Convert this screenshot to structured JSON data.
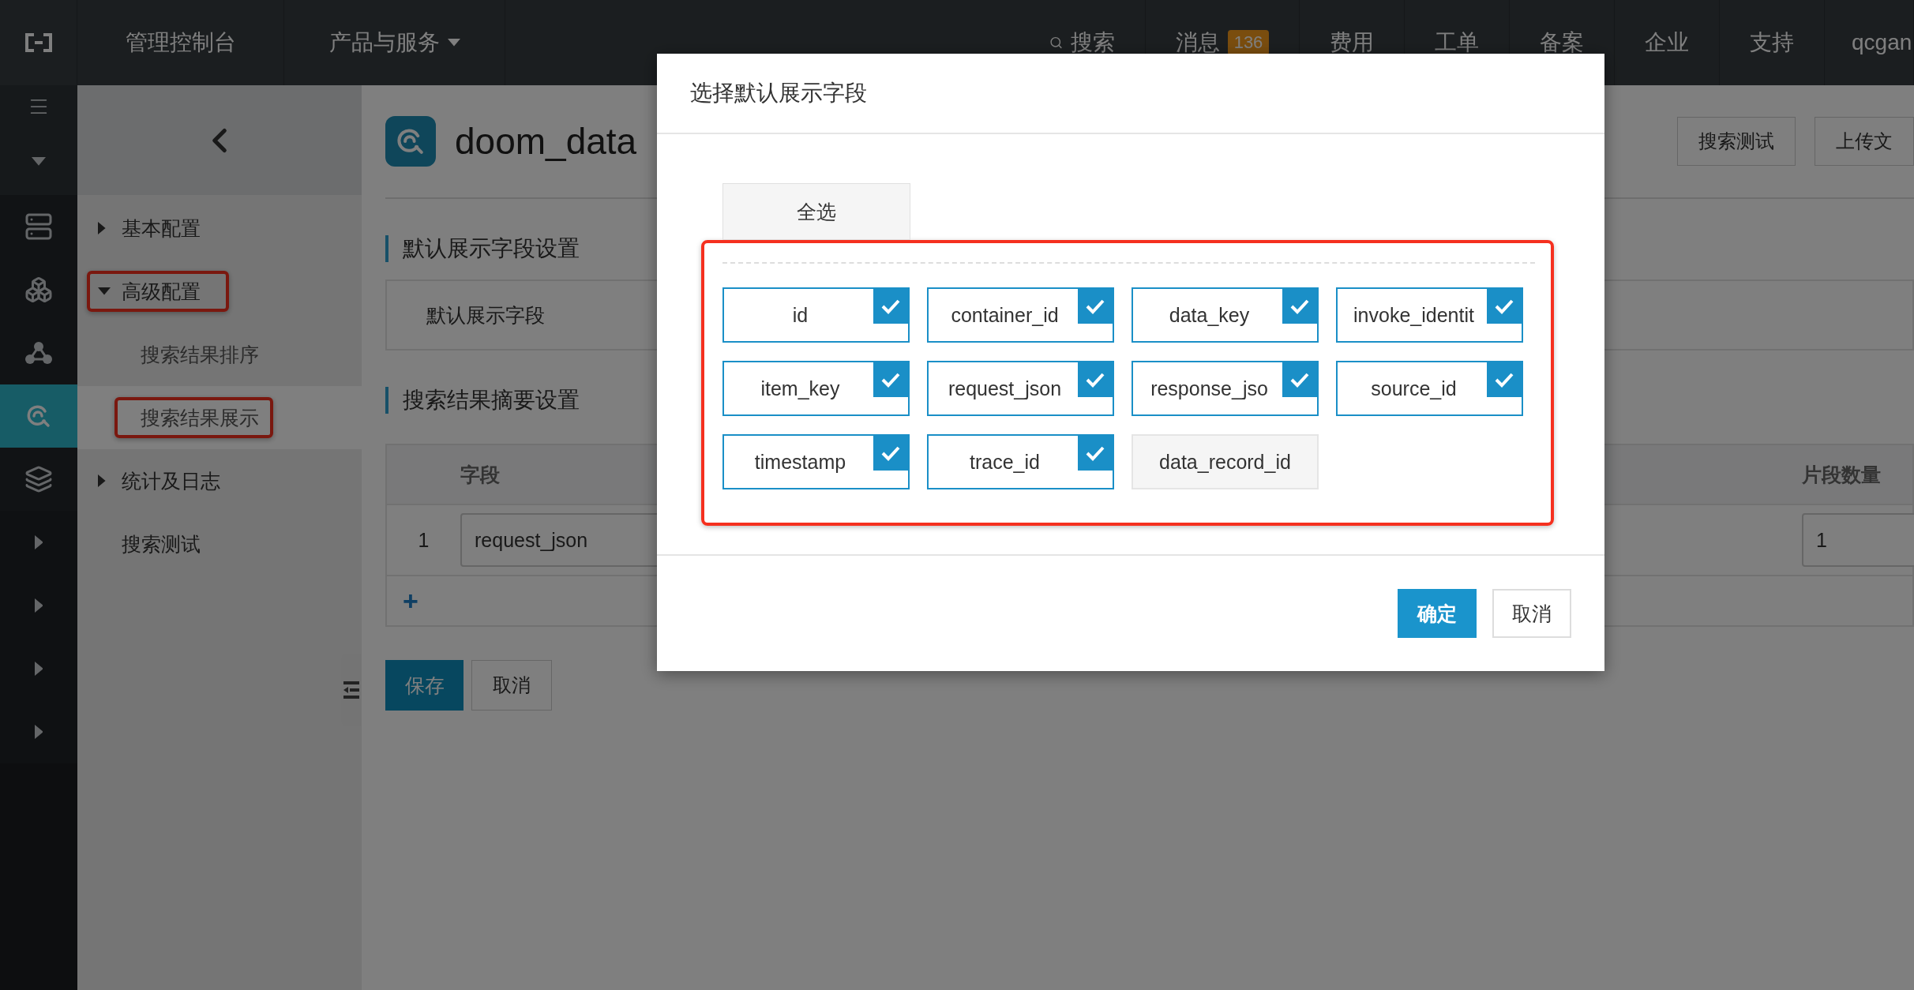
{
  "topbar": {
    "console": "管理控制台",
    "products": "产品与服务",
    "search": "搜索",
    "messages": {
      "label": "消息",
      "count": "136"
    },
    "links": [
      "费用",
      "工单",
      "备案",
      "企业",
      "支持"
    ],
    "user": "qcgan"
  },
  "rail": [
    {
      "kind": "menu",
      "selected": false
    },
    {
      "kind": "collapse",
      "selected": false
    },
    {
      "kind": "servers",
      "selected": false
    },
    {
      "kind": "cubes",
      "selected": false
    },
    {
      "kind": "nodes",
      "selected": false
    },
    {
      "kind": "search",
      "selected": true
    },
    {
      "kind": "layers",
      "selected": false
    },
    {
      "kind": "expand",
      "selected": false
    },
    {
      "kind": "expand",
      "selected": false
    },
    {
      "kind": "expand",
      "selected": false
    },
    {
      "kind": "expand",
      "selected": false
    }
  ],
  "sidebar": {
    "items": [
      {
        "kind": "group",
        "label": "基本配置",
        "expanded": false,
        "annotated": false
      },
      {
        "kind": "group",
        "label": "高级配置",
        "expanded": true,
        "annotated": true,
        "children": [
          {
            "label": "搜索结果排序",
            "selected": false,
            "annotated": false
          },
          {
            "label": "搜索结果展示",
            "selected": true,
            "annotated": true
          }
        ]
      },
      {
        "kind": "group",
        "label": "统计及日志",
        "expanded": false,
        "annotated": false
      },
      {
        "kind": "leaf",
        "label": "搜索测试",
        "selected": false,
        "annotated": false
      }
    ]
  },
  "page": {
    "title": "doom_data",
    "actions": [
      "搜索测试",
      "上传文"
    ],
    "default_fields": {
      "title": "默认展示字段设置",
      "label": "默认展示字段"
    },
    "summary": {
      "title": "搜索结果摘要设置",
      "columns": [
        "字段",
        "片段数量"
      ],
      "rows": [
        {
          "index": "1",
          "field": "request_json",
          "count": "1"
        }
      ],
      "add": "+"
    },
    "buttons": [
      "保存",
      "取消"
    ]
  },
  "modal": {
    "title": "选择默认展示字段",
    "select_all": "全选",
    "annotated": true,
    "fields": [
      {
        "label": "id",
        "checked": true
      },
      {
        "label": "container_id",
        "checked": true
      },
      {
        "label": "data_key",
        "checked": true
      },
      {
        "label": "invoke_identit",
        "checked": true
      },
      {
        "label": "item_key",
        "checked": true
      },
      {
        "label": "request_json",
        "checked": true
      },
      {
        "label": "response_jso",
        "checked": true
      },
      {
        "label": "source_id",
        "checked": true
      },
      {
        "label": "timestamp",
        "checked": true
      },
      {
        "label": "trace_id",
        "checked": true
      },
      {
        "label": "data_record_id",
        "checked": false
      }
    ],
    "buttons": [
      "确定",
      "取消"
    ]
  }
}
